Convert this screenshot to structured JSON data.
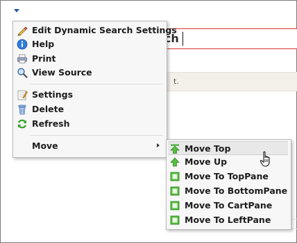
{
  "background": {
    "search_title_fragment": "rch",
    "help_fragment": "t."
  },
  "context_menu": {
    "items": [
      {
        "label": "Edit Dynamic Search Settings",
        "icon": "pencil-icon"
      },
      {
        "label": "Help",
        "icon": "help-icon"
      },
      {
        "label": "Print",
        "icon": "printer-icon"
      },
      {
        "label": "View Source",
        "icon": "magnifier-icon"
      },
      {
        "label": "Settings",
        "icon": "settings-icon"
      },
      {
        "label": "Delete",
        "icon": "trash-icon"
      },
      {
        "label": "Refresh",
        "icon": "refresh-icon"
      },
      {
        "label": "Move",
        "icon": "submenu-arrow-icon"
      }
    ]
  },
  "move_submenu": {
    "items": [
      {
        "label": "Move Top",
        "icon": "arrow-top-icon",
        "highlighted": true
      },
      {
        "label": "Move Up",
        "icon": "arrow-up-icon"
      },
      {
        "label": "Move To TopPane",
        "icon": "pane-icon"
      },
      {
        "label": "Move To BottomPane",
        "icon": "pane-icon"
      },
      {
        "label": "Move To CartPane",
        "icon": "pane-icon"
      },
      {
        "label": "Move To LeftPane",
        "icon": "pane-icon"
      }
    ]
  },
  "colors": {
    "accent_red": "#d93030",
    "icon_green": "#3aa62a",
    "icon_blue": "#2a5aa8"
  }
}
